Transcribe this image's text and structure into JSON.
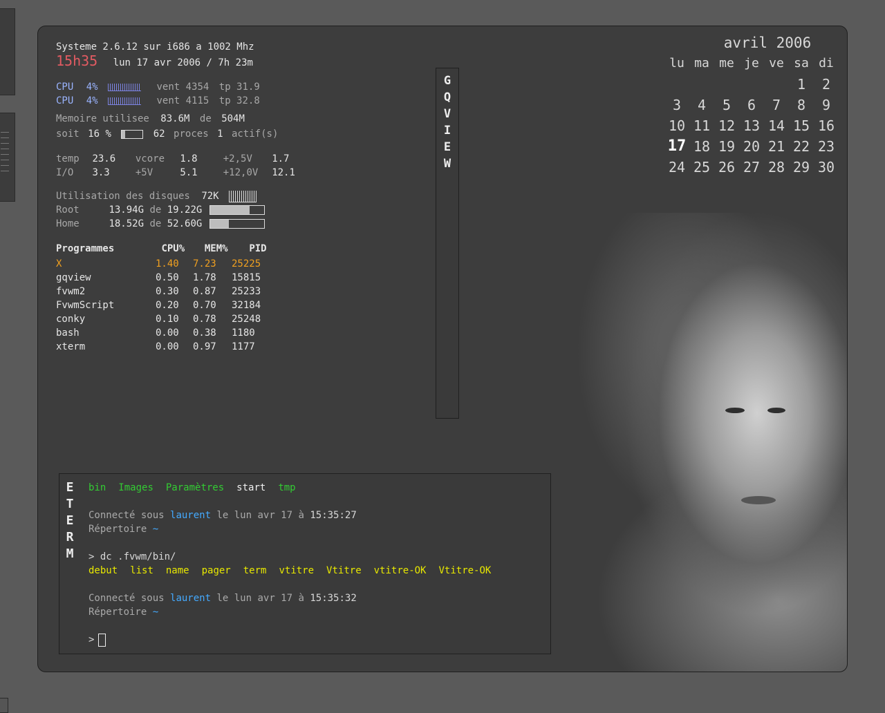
{
  "conky": {
    "system": "Systeme 2.6.12 sur i686 a 1002 Mhz",
    "clock": "15h35",
    "date": "lun 17 avr 2006 / 7h 23m",
    "cpu_rows": [
      {
        "label": "CPU",
        "value": "4%",
        "fan": "vent 4354",
        "temp": "tp 31.9"
      },
      {
        "label": "CPU",
        "value": "4%",
        "fan": "vent 4115",
        "temp": "tp 32.8"
      }
    ],
    "memory": {
      "label": "Memoire utilisee",
      "used": "83.6M",
      "of": "de",
      "total": "504M"
    },
    "memory_percent": {
      "prefix": "soit",
      "value": "16 %",
      "fill": 0.16,
      "procs": "62",
      "procs_label": "proces",
      "active": "1",
      "active_label": "actif(s)"
    },
    "sensors": [
      {
        "a": "temp",
        "av": "23.6",
        "b": "vcore",
        "bv": "1.8",
        "c": "+2,5V",
        "cv": "1.7"
      },
      {
        "a": "I/O",
        "av": "3.3",
        "b": "+5V",
        "bv": "5.1",
        "c": "+12,0V",
        "cv": "12.1"
      }
    ],
    "disk_usage": {
      "label": "Utilisation des disques",
      "value": "72K"
    },
    "disks": [
      {
        "name": "Root",
        "used": "13.94G",
        "of": "de",
        "total": "19.22G",
        "fill": 0.73
      },
      {
        "name": "Home",
        "used": "18.52G",
        "of": "de",
        "total": "52.60G",
        "fill": 0.35
      }
    ],
    "proc_header": {
      "name": "Programmes",
      "cpu": "CPU%",
      "mem": "MEM%",
      "pid": "PID"
    },
    "processes": [
      {
        "name": "X",
        "cpu": "1.40",
        "mem": "7.23",
        "pid": "25225"
      },
      {
        "name": "gqview",
        "cpu": "0.50",
        "mem": "1.78",
        "pid": "15815"
      },
      {
        "name": "fvwm2",
        "cpu": "0.30",
        "mem": "0.87",
        "pid": "25233"
      },
      {
        "name": "FvwmScript",
        "cpu": "0.20",
        "mem": "0.70",
        "pid": "32184"
      },
      {
        "name": "conky",
        "cpu": "0.10",
        "mem": "0.78",
        "pid": "25248"
      },
      {
        "name": "bash",
        "cpu": "0.00",
        "mem": "0.38",
        "pid": "1180"
      },
      {
        "name": "xterm",
        "cpu": "0.00",
        "mem": "0.97",
        "pid": "1177"
      }
    ]
  },
  "gqview_label": [
    "G",
    "Q",
    "V",
    "I",
    "E",
    "W"
  ],
  "calendar": {
    "title": "avril 2006",
    "weekdays": [
      "lu",
      "ma",
      "me",
      "je",
      "ve",
      "sa",
      "di"
    ],
    "days": [
      "",
      "",
      "",
      "",
      "",
      "1",
      "2",
      "3",
      "4",
      "5",
      "6",
      "7",
      "8",
      "9",
      "10",
      "11",
      "12",
      "13",
      "14",
      "15",
      "16",
      "17",
      "18",
      "19",
      "20",
      "21",
      "22",
      "23",
      "24",
      "25",
      "26",
      "27",
      "28",
      "29",
      "30"
    ],
    "today": "17"
  },
  "terminal": {
    "side_label": [
      "E",
      "T",
      "E",
      "R",
      "M"
    ],
    "dirs": [
      {
        "text": "bin",
        "color": "g"
      },
      {
        "text": "Images",
        "color": "g"
      },
      {
        "text": "Paramètres",
        "color": "g"
      },
      {
        "text": "start",
        "color": "w"
      },
      {
        "text": "tmp",
        "color": "g"
      }
    ],
    "login1": {
      "prefix": "Connecté sous",
      "user": "laurent",
      "mid": "le lun avr 17 à",
      "time": "15:35:27"
    },
    "repo1": {
      "label": "Répertoire",
      "path": "~"
    },
    "command": "> dc .fvwm/bin/",
    "files": [
      "debut",
      "list",
      "name",
      "pager",
      "term",
      "vtitre",
      "Vtitre",
      "vtitre-OK",
      "Vtitre-OK"
    ],
    "login2": {
      "prefix": "Connecté sous",
      "user": "laurent",
      "mid": "le lun avr 17 à",
      "time": "15:35:32"
    },
    "repo2": {
      "label": "Répertoire",
      "path": "~"
    },
    "prompt": ">"
  }
}
